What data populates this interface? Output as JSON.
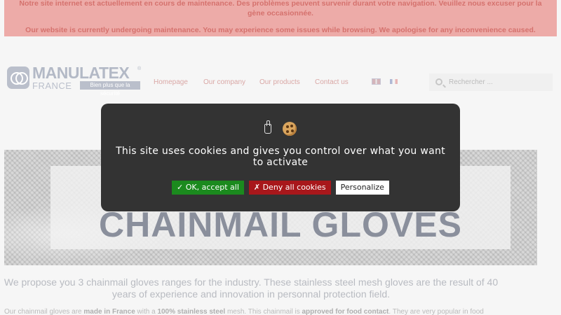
{
  "banner": {
    "message_fr": "Notre site internet est actuellement en cours de maintenance. Des problèmes peuvent survenir durant votre navigation. Veuillez nous excuser pour la gène occasionnée.",
    "message_en": "Our website is currently undergoing maintenance. You may experience some issues while browsing. We apologise for any inconvenience caused."
  },
  "logo": {
    "name": "MANULATEX",
    "registered": "®",
    "country": "FRANCE",
    "tagline": "Bien plus que la sécurité"
  },
  "nav": {
    "items": [
      {
        "label": "Homepage"
      },
      {
        "label": "Our company"
      },
      {
        "label": "Our products"
      },
      {
        "label": "Contact us"
      }
    ],
    "languages": [
      {
        "code": "en",
        "icon": "uk-flag-icon"
      },
      {
        "code": "fr",
        "icon": "france-flag-icon"
      }
    ]
  },
  "search": {
    "placeholder": "Rechercher ...",
    "value": "",
    "icon": "search-icon"
  },
  "hero": {
    "title": "CHAINMAIL GLOVES"
  },
  "intro": {
    "text": "We propose you 3 chainmail gloves ranges for the industry. These stainless steel mesh gloves are the result of 40 years of experience and innovation in personnal protection field."
  },
  "body": {
    "part1": "Our chainmail gloves are ",
    "bold1": "made in France",
    "part2": " with a ",
    "bold2": "100% stainless steel",
    "part3": " mesh. This chainmail is ",
    "bold3": "approved for food contact",
    "part4": ". They are very popular in food"
  },
  "cookie_banner": {
    "icons": [
      "hand-icon",
      "cookie-icon"
    ],
    "message": "This site uses cookies and gives you control over what you want to activate",
    "accept_label": "✓ OK, accept all",
    "deny_label": "✗ Deny all cookies",
    "personalize_label": "Personalize",
    "colors": {
      "background": "#333333",
      "accept": "#1b8a1e",
      "deny": "#a8171b",
      "personalize": "#ffffff"
    }
  }
}
